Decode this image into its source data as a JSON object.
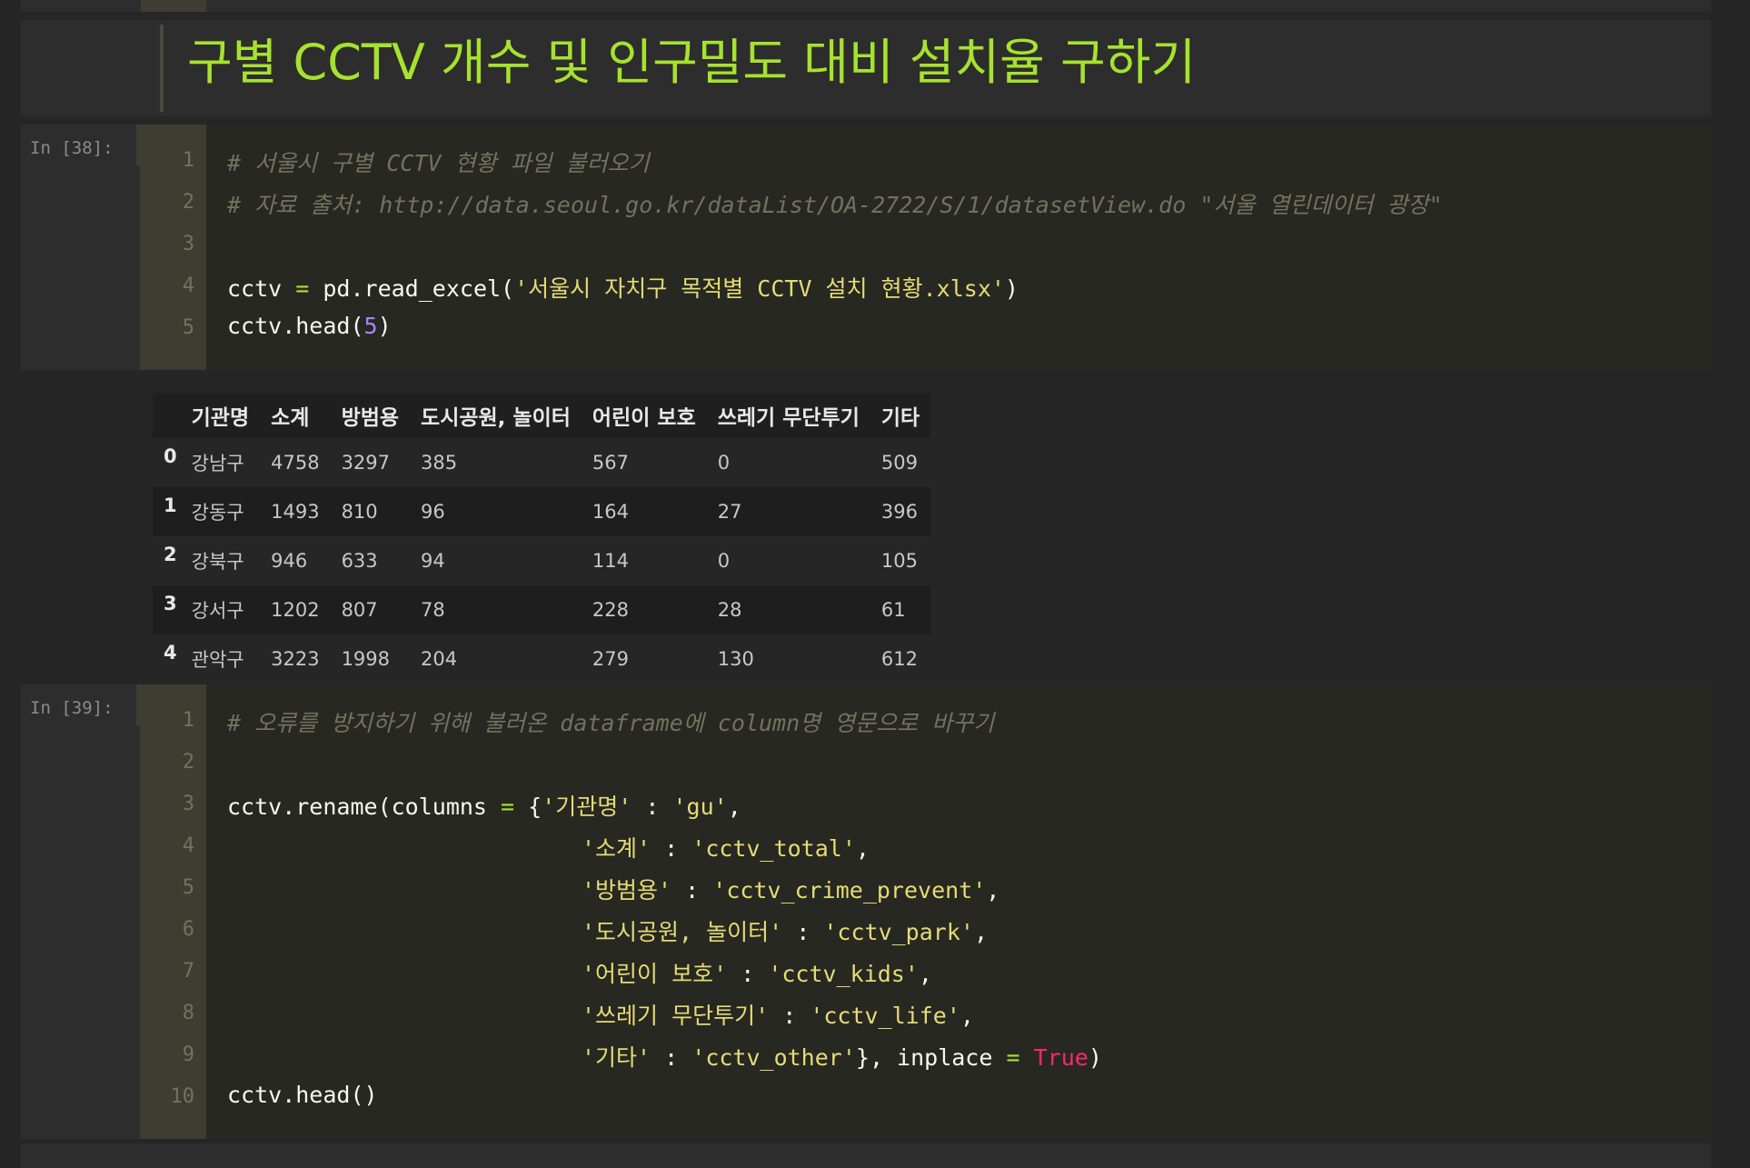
{
  "heading": "구별 CCTV 개수 및 인구밀도 대비 설치율 구하기",
  "cell1": {
    "prompt": "In [38]:",
    "line_numbers": [
      "1",
      "2",
      "3",
      "4",
      "5"
    ],
    "comment1": "# 서울시 구별 CCTV 현황 파일 불러오기",
    "comment2": "# 자료 출처: http://data.seoul.go.kr/dataList/OA-2722/S/1/datasetView.do \"서울 열린데이터 광장\"",
    "l4_var": "cctv",
    "l4_eq": " = ",
    "l4_call": "pd.read_excel(",
    "l4_str": "'서울시 자치구 목적별 CCTV 설치 현황.xlsx'",
    "l4_close": ")",
    "l5_call": "cctv.head(",
    "l5_num": "5",
    "l5_close": ")"
  },
  "table": {
    "columns": [
      "",
      "기관명",
      "소계",
      "방범용",
      "도시공원, 놀이터",
      "어린이 보호",
      "쓰레기 무단투기",
      "기타"
    ],
    "rows": [
      [
        "0",
        "강남구",
        "4758",
        "3297",
        "385",
        "567",
        "0",
        "509"
      ],
      [
        "1",
        "강동구",
        "1493",
        "810",
        "96",
        "164",
        "27",
        "396"
      ],
      [
        "2",
        "강북구",
        "946",
        "633",
        "94",
        "114",
        "0",
        "105"
      ],
      [
        "3",
        "강서구",
        "1202",
        "807",
        "78",
        "228",
        "28",
        "61"
      ],
      [
        "4",
        "관악구",
        "3223",
        "1998",
        "204",
        "279",
        "130",
        "612"
      ]
    ]
  },
  "cell2": {
    "prompt": "In [39]:",
    "line_numbers": [
      "1",
      "2",
      "3",
      "4",
      "5",
      "6",
      "7",
      "8",
      "9",
      "10"
    ],
    "comment1": "# 오류를 방지하기 위해 불러온 dataframe에 column명 영문으로 바꾸기",
    "l3_a": "cctv.rename(columns ",
    "l3_eq": "=",
    "l3_b": " {",
    "l3_k": "'기관명'",
    "l3_c": " : ",
    "l3_v": "'gu'",
    "l3_d": ",",
    "l4_k": "'소계'",
    "l4_c": " : ",
    "l4_v": "'cctv_total'",
    "l4_d": ",",
    "l5_k": "'방범용'",
    "l5_c": " : ",
    "l5_v": "'cctv_crime_prevent'",
    "l5_d": ",",
    "l6_k": "'도시공원, 놀이터'",
    "l6_c": " : ",
    "l6_v": "'cctv_park'",
    "l6_d": ",",
    "l7_k": "'어린이 보호'",
    "l7_c": " : ",
    "l7_v": "'cctv_kids'",
    "l7_d": ",",
    "l8_k": "'쓰레기 무단투기'",
    "l8_c": " : ",
    "l8_v": "'cctv_life'",
    "l8_d": ",",
    "l9_k": "'기타'",
    "l9_c": " : ",
    "l9_v": "'cctv_other'",
    "l9_d": "}, inplace ",
    "l9_eq": "=",
    "l9_sp": " ",
    "l9_kw": "True",
    "l9_close": ")",
    "l10": "cctv.head()"
  }
}
